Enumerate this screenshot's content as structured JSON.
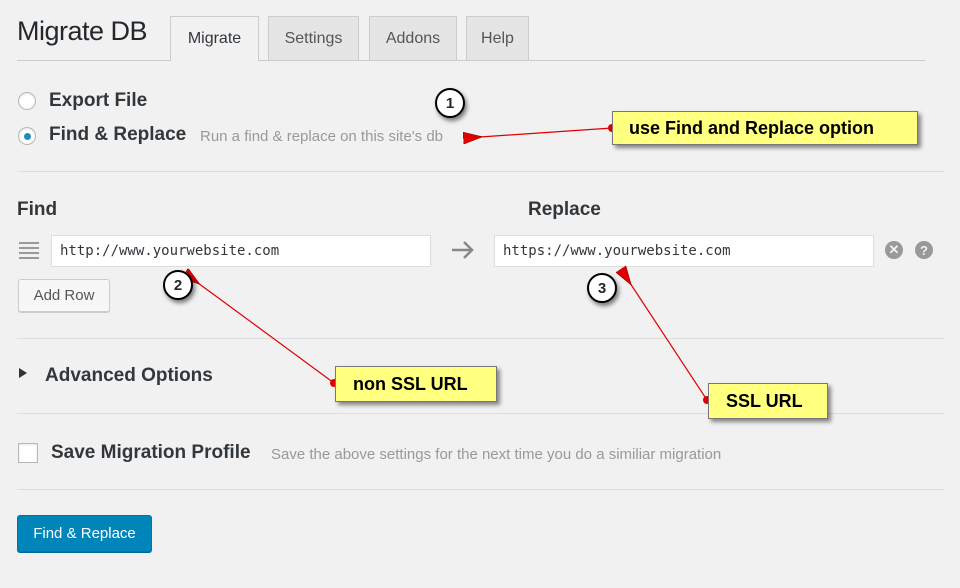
{
  "header": {
    "title": "Migrate DB",
    "tabs": [
      {
        "label": "Migrate",
        "active": true
      },
      {
        "label": "Settings",
        "active": false
      },
      {
        "label": "Addons",
        "active": false
      },
      {
        "label": "Help",
        "active": false
      }
    ]
  },
  "options": [
    {
      "label": "Export File",
      "description": "",
      "selected": false
    },
    {
      "label": "Find & Replace",
      "description": "Run a find & replace on this site's db",
      "selected": true
    }
  ],
  "find_replace": {
    "find_header": "Find",
    "replace_header": "Replace",
    "rows": [
      {
        "find": "http://www.yourwebsite.com",
        "replace": "https://www.yourwebsite.com"
      }
    ],
    "add_row_label": "Add Row",
    "arrow_icon": "arrow-right-icon",
    "remove_icon": "remove-row-icon",
    "help_icon": "help-icon"
  },
  "advanced": {
    "label": "Advanced Options",
    "expanded": false
  },
  "save_profile": {
    "label": "Save Migration Profile",
    "description": "Save the above settings for the next time you do a similiar migration",
    "checked": false
  },
  "submit_label": "Find & Replace",
  "annotations": {
    "callouts": [
      {
        "text": "use Find and Replace option"
      },
      {
        "text": "non SSL URL"
      },
      {
        "text": "SSL URL"
      }
    ],
    "badges": [
      "1",
      "2",
      "3"
    ],
    "colors": {
      "callout_bg": "#ffff80",
      "arrow": "#e00000"
    }
  },
  "colors": {
    "primary": "#0085ba",
    "radio_dot": "#1e8cbe",
    "background": "#f1f1f1"
  }
}
